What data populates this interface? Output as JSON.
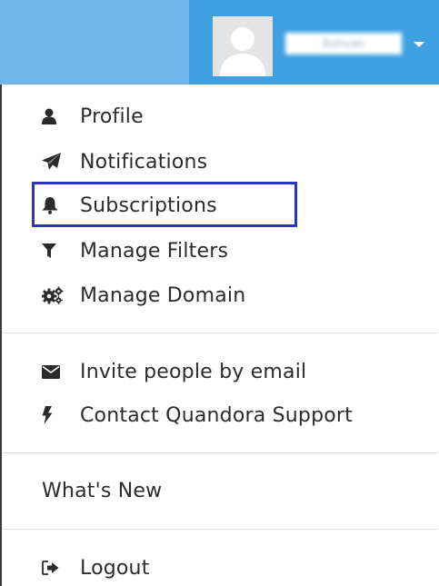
{
  "header": {
    "avatar_icon": "user-silhouette-icon",
    "username": "Bohuan",
    "caret_icon": "caret-down-icon",
    "colors": {
      "bar": "#6fb7ea",
      "user_area": "#3fa1e2"
    }
  },
  "menu": {
    "section1": [
      {
        "label": "Profile",
        "icon": "user-icon"
      },
      {
        "label": "Notifications",
        "icon": "paper-plane-icon"
      },
      {
        "label": "Subscriptions",
        "icon": "bell-icon"
      },
      {
        "label": "Manage Filters",
        "icon": "filter-icon"
      },
      {
        "label": "Manage Domain",
        "icon": "gears-icon",
        "highlighted": true
      }
    ],
    "section2": [
      {
        "label": "Invite people by email",
        "icon": "envelope-icon"
      },
      {
        "label": "Contact Quandora Support",
        "icon": "bolt-icon"
      }
    ],
    "section3": [
      {
        "label": "What's New"
      }
    ],
    "section4": [
      {
        "label": "Logout",
        "icon": "sign-out-icon"
      }
    ],
    "highlight_color": "#2a34c2"
  }
}
